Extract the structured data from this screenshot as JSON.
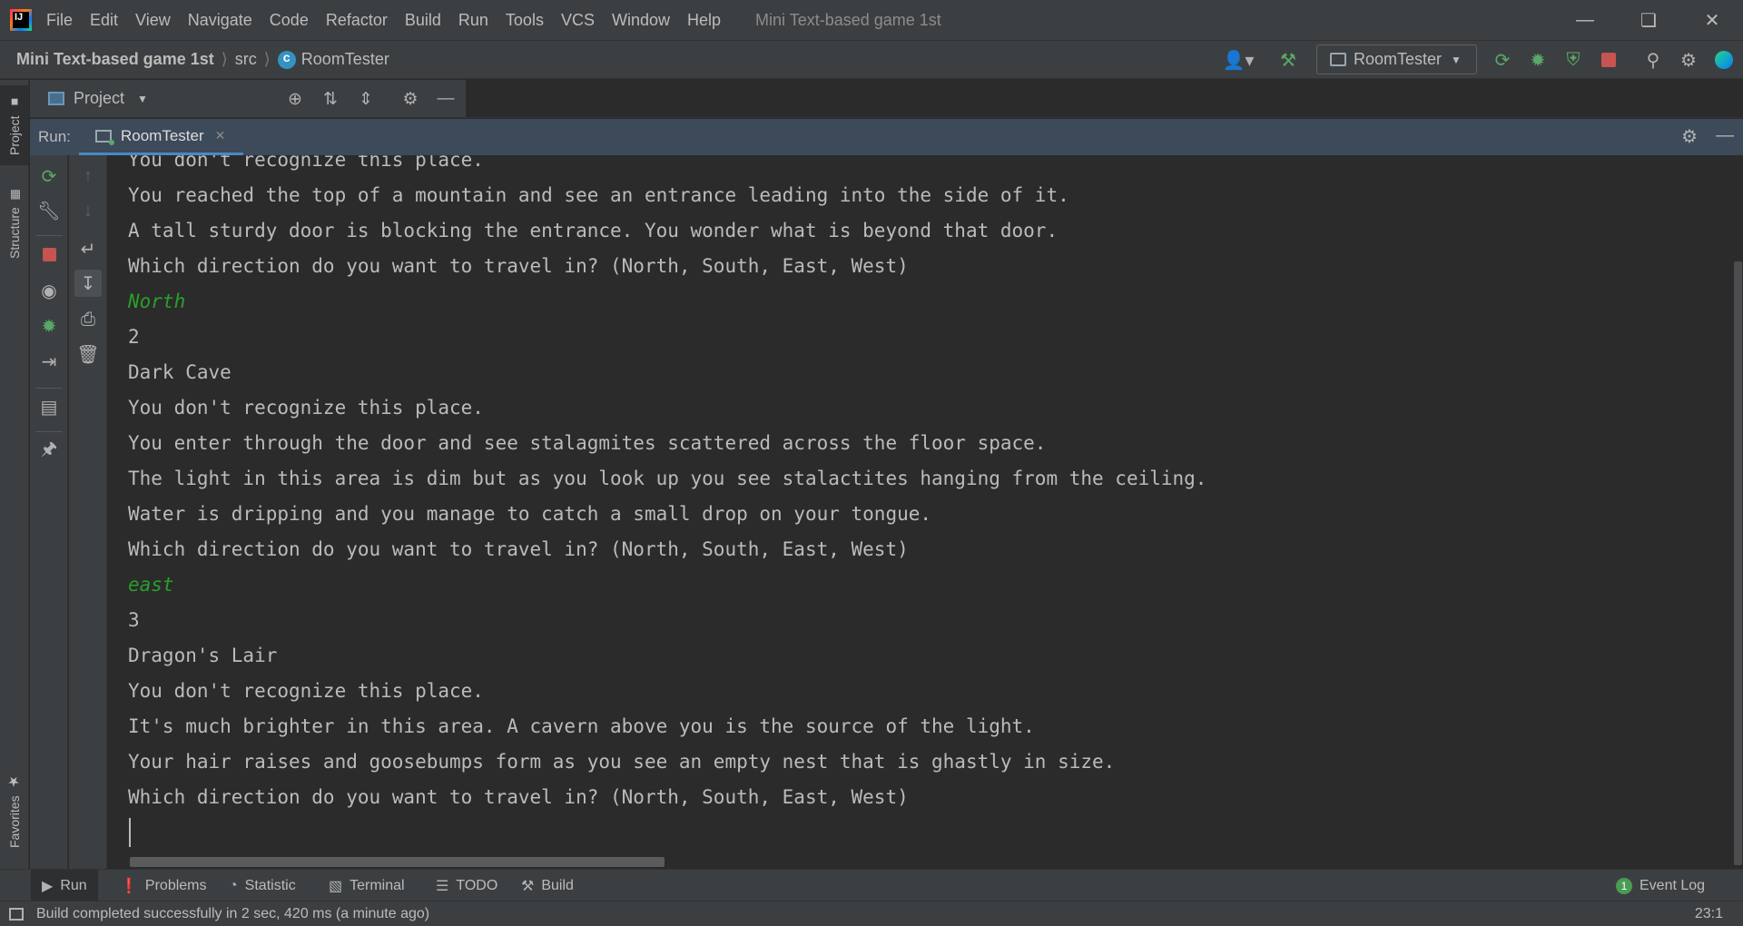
{
  "titlebar": {
    "menu": [
      "File",
      "Edit",
      "View",
      "Navigate",
      "Code",
      "Refactor",
      "Build",
      "Run",
      "Tools",
      "VCS",
      "Window",
      "Help"
    ],
    "window_title": "Mini Text-based game 1st"
  },
  "navbar": {
    "project": "Mini Text-based game 1st",
    "folder": "src",
    "file": "RoomTester",
    "run_config": "RoomTester"
  },
  "left_stripe": {
    "project_tab": "Project",
    "structure_tab": "Structure",
    "favorites_tab": "Favorites"
  },
  "project_panel": {
    "title": "Project"
  },
  "run_panel": {
    "label": "Run:",
    "tab": "RoomTester"
  },
  "console": {
    "lines": [
      {
        "text": "You don't recognize this place.",
        "kind": "output"
      },
      {
        "text": "You reached the top of a mountain and see an entrance leading into the side of it.",
        "kind": "output"
      },
      {
        "text": "A tall sturdy door is blocking the entrance. You wonder what is beyond that door.",
        "kind": "output"
      },
      {
        "text": "Which direction do you want to travel in? (North, South, East, West)",
        "kind": "output"
      },
      {
        "text": "North",
        "kind": "input"
      },
      {
        "text": "2",
        "kind": "output"
      },
      {
        "text": "Dark Cave",
        "kind": "output"
      },
      {
        "text": "You don't recognize this place.",
        "kind": "output"
      },
      {
        "text": "You enter through the door and see stalagmites scattered across the floor space.",
        "kind": "output"
      },
      {
        "text": "The light in this area is dim but as you look up you see stalactites hanging from the ceiling.",
        "kind": "output"
      },
      {
        "text": "Water is dripping and you manage to catch a small drop on your tongue.",
        "kind": "output"
      },
      {
        "text": "Which direction do you want to travel in? (North, South, East, West)",
        "kind": "output"
      },
      {
        "text": "east",
        "kind": "input"
      },
      {
        "text": "3",
        "kind": "output"
      },
      {
        "text": "Dragon's Lair",
        "kind": "output"
      },
      {
        "text": "You don't recognize this place.",
        "kind": "output"
      },
      {
        "text": "It's much brighter in this area. A cavern above you is the source of the light.",
        "kind": "output"
      },
      {
        "text": "Your hair raises and goosebumps form as you see an empty nest that is ghastly in size.",
        "kind": "output"
      },
      {
        "text": "Which direction do you want to travel in? (North, South, East, West)",
        "kind": "output"
      }
    ]
  },
  "bottom_tabs": {
    "run": "Run",
    "problems": "Problems",
    "statistic": "Statistic",
    "terminal": "Terminal",
    "todo": "TODO",
    "build": "Build",
    "event_log": "Event Log",
    "event_log_count": "1"
  },
  "status_bar": {
    "message": "Build completed successfully in 2 sec, 420 ms (a minute ago)",
    "cursor_position": "23:1"
  },
  "colors": {
    "background": "#2b2b2b",
    "panel": "#3c3f41",
    "run_header": "#3c4a5a",
    "console_text": "#bbbbbb",
    "user_input": "#2a9f2a",
    "run_green": "#59a869",
    "stop_red": "#c75450"
  }
}
